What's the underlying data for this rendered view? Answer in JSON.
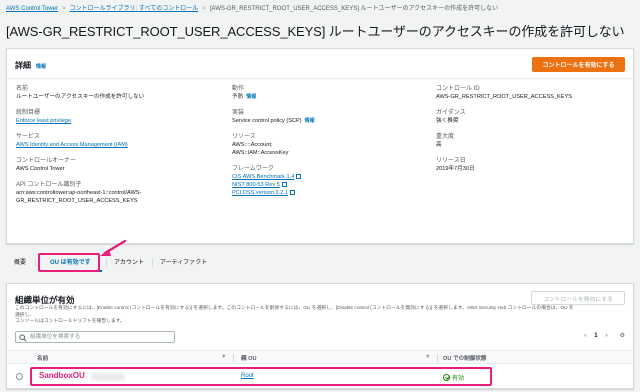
{
  "breadcrumb": {
    "items": [
      "AWS Control Tower",
      "コントロールライブラリ: すべてのコントロール",
      "[AWS-GR_RESTRICT_ROOT_USER_ACCESS_KEYS] ルートユーザーのアクセスキーの作成を許可しない"
    ],
    "separator": ">"
  },
  "page_title": "[AWS-GR_RESTRICT_ROOT_USER_ACCESS_KEYS] ルートユーザーのアクセスキーの作成を許可しない",
  "details": {
    "title": "詳細",
    "info": "情報",
    "enable_button": "コントロールを有効にする",
    "col1": {
      "name_label": "名前",
      "name_value": "ルートユーザーのアクセスキーの作成を許可しない",
      "goal_label": "統制目標",
      "goal_value": "Enforce least privilege",
      "service_label": "サービス",
      "service_value": "AWS Identity and Access Management (IAM)",
      "owner_label": "コントロールオーナー",
      "owner_value": "AWS Control Tower",
      "api_label": "API コントロール識別子",
      "api_value_1": "arn:aws:controltower:ap-northeast-1::control/AWS-",
      "api_value_2": "GR_RESTRICT_ROOT_USER_ACCESS_KEYS"
    },
    "col2": {
      "behavior_label": "動作",
      "behavior_value": "予防",
      "behavior_info": "情報",
      "impl_label": "実装",
      "impl_value": "Service control policy (SCP)",
      "impl_info": "情報",
      "resources_label": "リソース",
      "resources_1": "AWS::::Account;",
      "resources_2": "AWS::IAM::AccessKey",
      "framework_label": "フレームワーク",
      "frameworks": [
        "CIS AWS Benchmark 1.4",
        "NIST 800-53 Rev 5",
        "PCI DSS version 3.2.1"
      ]
    },
    "col3": {
      "id_label": "コントロール ID",
      "id_value": "AWS-GR_RESTRICT_ROOT_USER_ACCESS_KEYS",
      "guidance_label": "ガイダンス",
      "guidance_value": "強く推奨",
      "severity_label": "重大度",
      "severity_value": "高",
      "release_label": "リリース日",
      "release_value": "2019年7月30日"
    }
  },
  "tabs": [
    "概要",
    "OU は有効です",
    "アカウント",
    "アーティファクト"
  ],
  "ou_panel": {
    "title": "組織単位が有効",
    "description_1": "このコントロールを有効にするには、[Enable control (コントロールを有効にする)] を選択します。このコントロールを削除するには、OU を選択し、[Disable control (コントロールを無効にする)] を選択します。AWS Security Hub コントロールの場合は、OU を選択し、",
    "description_2": "コンソールはコントロールドリフトを報告します。",
    "disable_button": "コントロールを無効にする",
    "search_placeholder": "組織単位を検索する",
    "page_number": "1",
    "columns": [
      "名前",
      "親 OU",
      "OU での制御状態"
    ],
    "rows": [
      {
        "name": "SandboxOU",
        "parent": "Root",
        "status": "有効"
      }
    ]
  },
  "colors": {
    "accent": "#0073bb",
    "primary": "#ec7211",
    "highlight": "#e91e7b",
    "success": "#1d8102"
  }
}
